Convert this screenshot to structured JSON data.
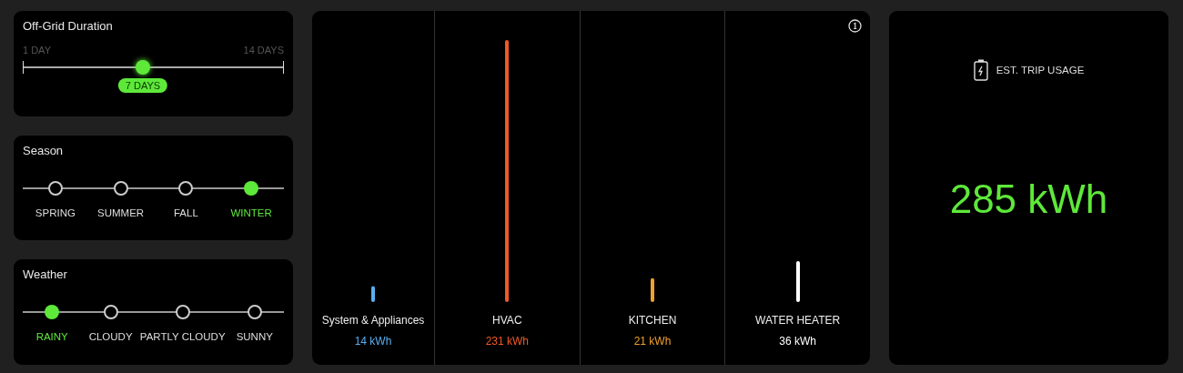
{
  "duration": {
    "title": "Off-Grid Duration",
    "min_label": "1 DAY",
    "max_label": "14 DAYS",
    "level": 0.46,
    "value": "7 DAYS"
  },
  "season": {
    "title": "Season",
    "options": [
      {
        "label": "SPRING",
        "selected": false
      },
      {
        "label": "SUMMER",
        "selected": false
      },
      {
        "label": "FALL",
        "selected": false
      },
      {
        "label": "WINTER",
        "selected": true
      }
    ]
  },
  "weather": {
    "title": "Weather",
    "options": [
      {
        "label": "RAINY",
        "selected": true
      },
      {
        "label": "CLOUDY",
        "selected": false
      },
      {
        "label": "PARTLY CLOUDY",
        "selected": false
      },
      {
        "label": "SUNNY",
        "selected": false
      }
    ]
  },
  "usage_breakdown": {
    "chart_data": {
      "type": "bar",
      "categories": [
        "System & Appliances",
        "HVAC",
        "KITCHEN",
        "WATER HEATER"
      ],
      "values": [
        14,
        231,
        21,
        36
      ],
      "value_labels": [
        "14 kWh",
        "231 kWh",
        "21 kWh",
        "36 kWh"
      ]
    },
    "items": [
      {
        "color": "#5aaef0"
      },
      {
        "color": "#f05a28"
      },
      {
        "color": "#f0a030"
      },
      {
        "color": "#ffffff"
      }
    ]
  },
  "trip_usage": {
    "title": "EST. TRIP USAGE",
    "value": "285 kWh"
  }
}
